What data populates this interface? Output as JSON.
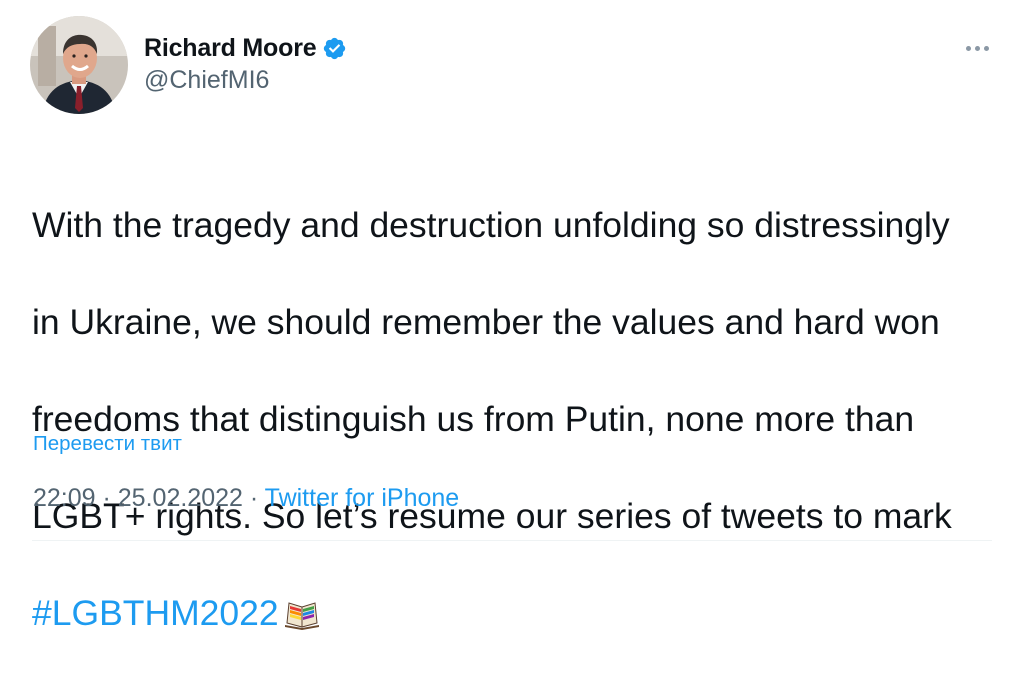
{
  "author": {
    "display_name": "Richard Moore",
    "handle": "@ChiefMI6",
    "verified": true,
    "avatar_icon": "profile-photo"
  },
  "tweet": {
    "lines": [
      "With the tragedy and destruction unfolding so distressingly",
      "in Ukraine, we should remember the values and hard won",
      "freedoms that distinguish us from Putin, none more than",
      "LGBT+ rights. So let’s resume our series of tweets to mark"
    ],
    "hashtag": "#LGBTHM2022",
    "emoji_icon": "rainbow-book-icon"
  },
  "translate_label": "Перевести твит",
  "meta": {
    "time": "22:09",
    "separator": " · ",
    "date": "25.02.2022",
    "source": "Twitter for iPhone"
  },
  "colors": {
    "link": "#1d9bf0",
    "secondary_text": "#536471",
    "primary_text": "#0f1419",
    "verified_badge": "#1d9bf0"
  }
}
